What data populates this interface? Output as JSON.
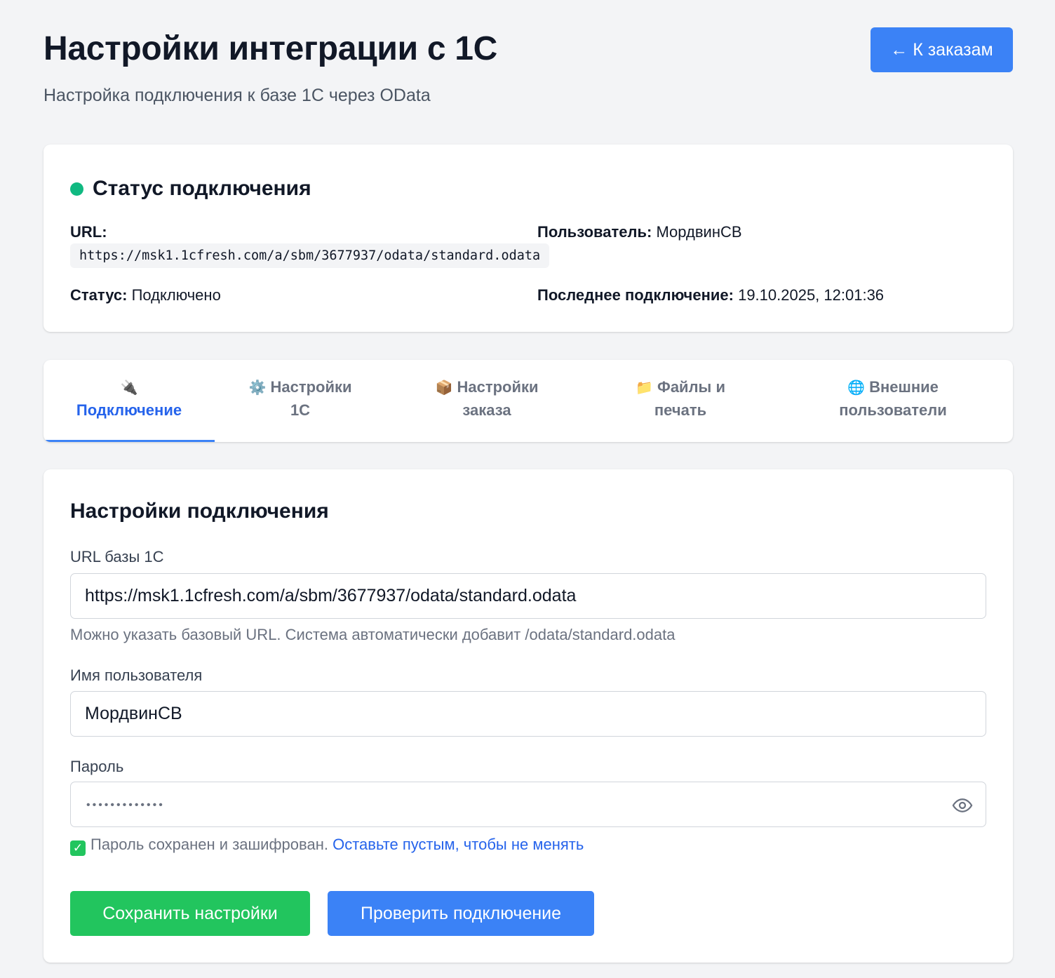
{
  "header": {
    "title": "Настройки интеграции с 1С",
    "subtitle": "Настройка подключения к базе 1С через OData",
    "back_button": "← К заказам"
  },
  "status": {
    "title": "Статус подключения",
    "dot_color": "#10b981",
    "url_label": "URL:",
    "url_value": "https://msk1.1cfresh.com/a/sbm/3677937/odata/standard.odata",
    "user_label": "Пользователь:",
    "user_value": "МордвинСВ",
    "status_label": "Статус:",
    "status_value": "Подключено",
    "last_label": "Последнее подключение:",
    "last_value": "19.10.2025, 12:01:36"
  },
  "tabs": [
    {
      "icon": "🔌",
      "label": "Подключение",
      "active": true
    },
    {
      "icon": "⚙️",
      "label_l1": "Настройки",
      "label_l2": "1С"
    },
    {
      "icon": "📦",
      "label_l1": "Настройки",
      "label_l2": "заказа"
    },
    {
      "icon": "📁",
      "label_l1": "Файлы и",
      "label_l2": "печать"
    },
    {
      "icon": "🌐",
      "label_l1": "Внешние",
      "label_l2": "пользователи"
    }
  ],
  "form": {
    "title": "Настройки подключения",
    "url_label": "URL базы 1С",
    "url_value": "https://msk1.1cfresh.com/a/sbm/3677937/odata/standard.odata",
    "url_hint": "Можно указать базовый URL. Система автоматически добавит /odata/standard.odata",
    "user_label": "Имя пользователя",
    "user_value": "МордвинСВ",
    "password_label": "Пароль",
    "password_mask": "•••••••••••••",
    "password_hint": "Пароль сохранен и зашифрован.",
    "password_hint_link": "Оставьте пустым, чтобы не менять",
    "save_button": "Сохранить настройки",
    "test_button": "Проверить подключение"
  },
  "colors": {
    "primary": "#3b82f6",
    "success": "#22c55e",
    "link": "#2563eb"
  }
}
